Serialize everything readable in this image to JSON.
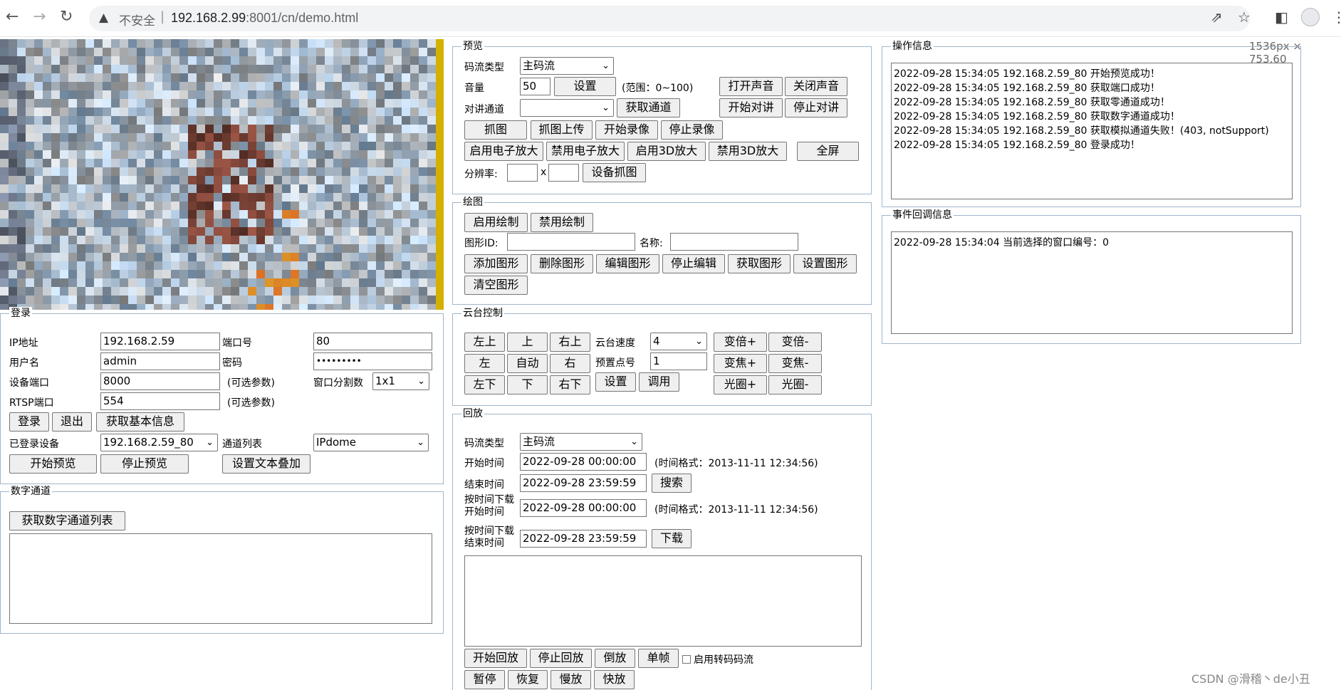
{
  "browser": {
    "insecure_label": "不安全",
    "url_host": "192.168.2.99",
    "url_path": ":8001/cn/demo.html",
    "dim_tag": "1536px × 753.60"
  },
  "preview": {
    "legend": "预览",
    "stream_type_label": "码流类型",
    "stream_type_value": "主码流",
    "volume_label": "音量",
    "volume_value": "50",
    "set_btn": "设置",
    "range_text": "(范围：0~100)",
    "open_sound": "打开声音",
    "close_sound": "关闭声音",
    "talk_channel_label": "对讲通道",
    "get_channel": "获取通道",
    "start_talk": "开始对讲",
    "stop_talk": "停止对讲",
    "capture": "抓图",
    "capture_upload": "抓图上传",
    "start_record": "开始录像",
    "stop_record": "停止录像",
    "enable_ezoom": "启用电子放大",
    "disable_ezoom": "禁用电子放大",
    "enable_3d": "启用3D放大",
    "disable_3d": "禁用3D放大",
    "fullscreen": "全屏",
    "resolution_label": "分辨率:",
    "x_label": "x",
    "set_capture": "设备抓图"
  },
  "draw": {
    "legend": "绘图",
    "enable": "启用绘制",
    "disable": "禁用绘制",
    "shape_id_label": "图形ID:",
    "name_label": "名称:",
    "add": "添加图形",
    "delete": "删除图形",
    "edit": "编辑图形",
    "stop_edit": "停止编辑",
    "get": "获取图形",
    "set": "设置图形",
    "clear": "清空图形"
  },
  "ptz": {
    "legend": "云台控制",
    "up_left": "左上",
    "up": "上",
    "up_right": "右上",
    "left": "左",
    "auto": "自动",
    "right": "右",
    "down_left": "左下",
    "down": "下",
    "down_right": "右下",
    "speed_label": "云台速度",
    "speed_value": "4",
    "preset_label": "预置点号",
    "preset_value": "1",
    "set": "设置",
    "call": "调用",
    "zoom_in": "变倍+",
    "zoom_out": "变倍-",
    "focus_in": "变焦+",
    "focus_out": "变焦-",
    "iris_in": "光圈+",
    "iris_out": "光圈-"
  },
  "playback": {
    "legend": "回放",
    "stream_type_label": "码流类型",
    "stream_type_value": "主码流",
    "start_time_label": "开始时间",
    "start_time_value": "2022-09-28 00:00:00",
    "time_format_hint": "(时间格式：2013-11-11 12:34:56)",
    "end_time_label": "结束时间",
    "end_time_value": "2022-09-28 23:59:59",
    "search": "搜索",
    "dl_start_label_1": "按时间下载",
    "dl_start_label_2": "开始时间",
    "dl_start_value": "2022-09-28 00:00:00",
    "dl_end_label_1": "按时间下载",
    "dl_end_label_2": "结束时间",
    "dl_end_value": "2022-09-28 23:59:59",
    "download": "下载",
    "start_playback": "开始回放",
    "stop_playback": "停止回放",
    "reverse": "倒放",
    "single_frame": "单帧",
    "transcode_label": "启用转码码流",
    "pause": "暂停",
    "resume": "恢复",
    "slow": "慢放",
    "fast": "快放"
  },
  "login": {
    "legend": "登录",
    "ip_label": "IP地址",
    "ip_value": "192.168.2.59",
    "port_label": "端口号",
    "port_value": "80",
    "user_label": "用户名",
    "user_value": "admin",
    "pwd_label": "密码",
    "pwd_value": "•••••••••",
    "dev_port_label": "设备端口",
    "dev_port_value": "8000",
    "optional_1": "(可选参数)",
    "split_label": "窗口分割数",
    "split_value": "1x1",
    "rtsp_label": "RTSP端口",
    "rtsp_value": "554",
    "optional_2": "(可选参数)",
    "login_btn": "登录",
    "logout_btn": "退出",
    "get_info_btn": "获取基本信息",
    "logged_label": "已登录设备",
    "logged_value": "192.168.2.59_80",
    "channel_list_label": "通道列表",
    "channel_list_value": "IPdome",
    "start_preview": "开始预览",
    "stop_preview": "停止预览",
    "set_osd": "设置文本叠加"
  },
  "digital": {
    "legend": "数字通道",
    "get_list": "获取数字通道列表"
  },
  "ops": {
    "legend": "操作信息",
    "lines": [
      "2022-09-28 15:34:05 192.168.2.59_80 开始预览成功！",
      "2022-09-28 15:34:05 192.168.2.59_80 获取端口成功！",
      "2022-09-28 15:34:05 192.168.2.59_80 获取零通道成功！",
      "2022-09-28 15:34:05 192.168.2.59_80 获取数字通道成功！",
      "2022-09-28 15:34:05 192.168.2.59_80 获取模拟通道失败！(403, notSupport)",
      "2022-09-28 15:34:05 192.168.2.59_80 登录成功！"
    ]
  },
  "events": {
    "legend": "事件回调信息",
    "lines": [
      "2022-09-28 15:34:04 当前选择的窗口编号：0"
    ]
  },
  "watermark": "CSDN @滑稽丶de小丑"
}
